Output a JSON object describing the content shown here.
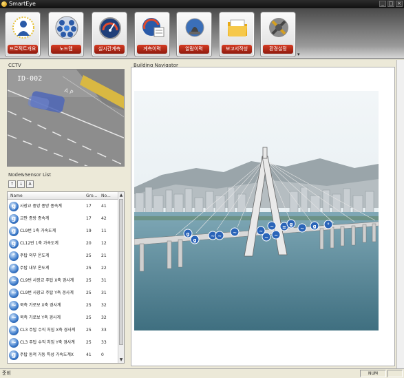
{
  "window": {
    "title": "SmartEye"
  },
  "toolbar": {
    "buttons": [
      {
        "label": "프로젝트개요",
        "icon": "project-overview-icon"
      },
      {
        "label": "노드맵",
        "icon": "node-map-icon"
      },
      {
        "label": "실시간계측",
        "icon": "realtime-gauge-icon"
      },
      {
        "label": "계측이력",
        "icon": "measurement-history-icon"
      },
      {
        "label": "알람이력",
        "icon": "alarm-history-icon"
      },
      {
        "label": "보고서작성",
        "icon": "report-folder-icon"
      },
      {
        "label": "환경설정",
        "icon": "settings-tools-icon"
      }
    ]
  },
  "cctv": {
    "label": "CCTV",
    "overlay": "ID-002"
  },
  "node_list": {
    "label": "Node&Sensor List",
    "columns": [
      "Name",
      "Gro...",
      "No..."
    ],
    "rows": [
      {
        "icon": "g",
        "name": "사장교 중앙 종방 종속계",
        "group": "17",
        "no": "41"
      },
      {
        "icon": "g",
        "name": "교판 종방 종속계",
        "group": "17",
        "no": "42"
      },
      {
        "icon": "g",
        "name": "CL9번 1축 가속도계",
        "group": "19",
        "no": "11"
      },
      {
        "icon": "g",
        "name": "CL12번 1축 가속도계",
        "group": "20",
        "no": "12"
      },
      {
        "icon": "t",
        "name": "주탑 외부 온도계",
        "group": "25",
        "no": "21"
      },
      {
        "icon": "t",
        "name": "주탑 내부 온도계",
        "group": "25",
        "no": "22"
      },
      {
        "icon": "a",
        "name": "CL9번 사장교 주탑 X축 경사계",
        "group": "25",
        "no": "31"
      },
      {
        "icon": "a",
        "name": "CL9번 사장교 주탑 Y축 경사계",
        "group": "25",
        "no": "31"
      },
      {
        "icon": "a",
        "name": "북측 가로보 X축 경사계",
        "group": "25",
        "no": "32"
      },
      {
        "icon": "a",
        "name": "북측 가로보 Y축 경사계",
        "group": "25",
        "no": "32"
      },
      {
        "icon": "a",
        "name": "CL3 주탑 수직 처짐 X축 경사계",
        "group": "25",
        "no": "33"
      },
      {
        "icon": "a",
        "name": "CL3 주탑 수직 처짐 Y축 경사계",
        "group": "25",
        "no": "33"
      },
      {
        "icon": "g",
        "name": "주탑 동적 거동 특성 가속도계X",
        "group": "41",
        "no": "0"
      }
    ]
  },
  "navigator": {
    "label": "Building Navigator"
  },
  "status": {
    "left_text": "준비",
    "num_indicator": "NUM"
  }
}
